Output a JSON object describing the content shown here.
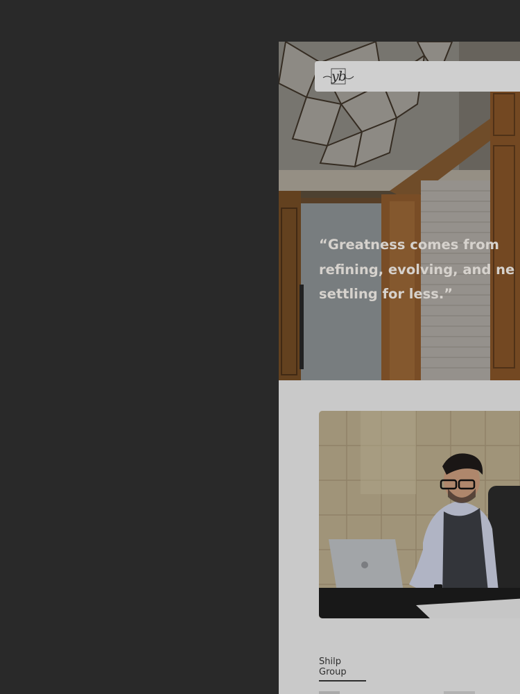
{
  "header": {
    "logo_text": "yb",
    "logo_icon": "signature-monogram-logo"
  },
  "hero": {
    "quote_lines": [
      "“Greatness comes from",
      "refining, evolving, and ne",
      "settling for less.”"
    ]
  },
  "about": {
    "photo_description": "portrait-photo",
    "company_link": "Shilp Group"
  },
  "colors": {
    "backdrop": "#292929",
    "panel": "#c9c9c9",
    "quote_text": "#d6d2cd"
  }
}
